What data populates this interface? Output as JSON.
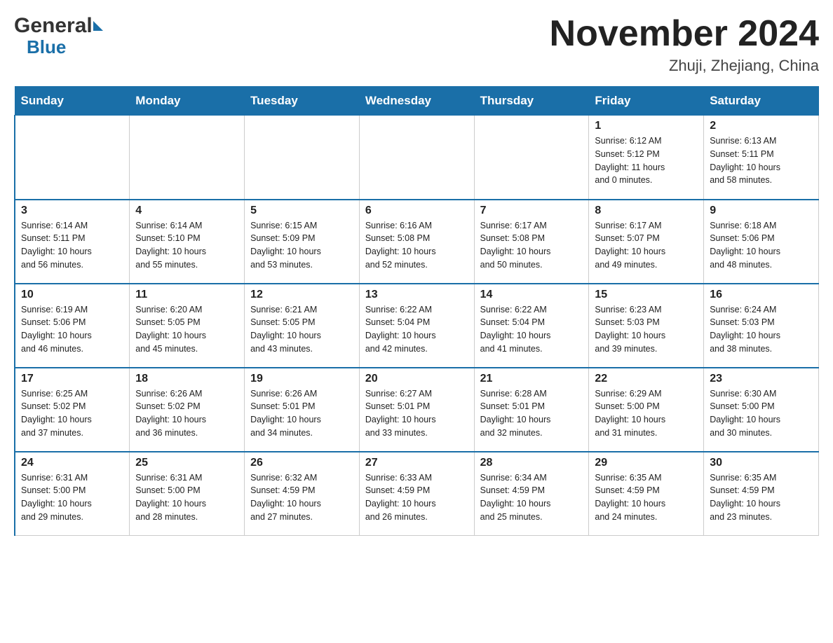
{
  "header": {
    "title": "November 2024",
    "subtitle": "Zhuji, Zhejiang, China",
    "logo_general": "General",
    "logo_blue": "Blue"
  },
  "weekdays": [
    "Sunday",
    "Monday",
    "Tuesday",
    "Wednesday",
    "Thursday",
    "Friday",
    "Saturday"
  ],
  "weeks": [
    [
      {
        "day": "",
        "info": ""
      },
      {
        "day": "",
        "info": ""
      },
      {
        "day": "",
        "info": ""
      },
      {
        "day": "",
        "info": ""
      },
      {
        "day": "",
        "info": ""
      },
      {
        "day": "1",
        "info": "Sunrise: 6:12 AM\nSunset: 5:12 PM\nDaylight: 11 hours\nand 0 minutes."
      },
      {
        "day": "2",
        "info": "Sunrise: 6:13 AM\nSunset: 5:11 PM\nDaylight: 10 hours\nand 58 minutes."
      }
    ],
    [
      {
        "day": "3",
        "info": "Sunrise: 6:14 AM\nSunset: 5:11 PM\nDaylight: 10 hours\nand 56 minutes."
      },
      {
        "day": "4",
        "info": "Sunrise: 6:14 AM\nSunset: 5:10 PM\nDaylight: 10 hours\nand 55 minutes."
      },
      {
        "day": "5",
        "info": "Sunrise: 6:15 AM\nSunset: 5:09 PM\nDaylight: 10 hours\nand 53 minutes."
      },
      {
        "day": "6",
        "info": "Sunrise: 6:16 AM\nSunset: 5:08 PM\nDaylight: 10 hours\nand 52 minutes."
      },
      {
        "day": "7",
        "info": "Sunrise: 6:17 AM\nSunset: 5:08 PM\nDaylight: 10 hours\nand 50 minutes."
      },
      {
        "day": "8",
        "info": "Sunrise: 6:17 AM\nSunset: 5:07 PM\nDaylight: 10 hours\nand 49 minutes."
      },
      {
        "day": "9",
        "info": "Sunrise: 6:18 AM\nSunset: 5:06 PM\nDaylight: 10 hours\nand 48 minutes."
      }
    ],
    [
      {
        "day": "10",
        "info": "Sunrise: 6:19 AM\nSunset: 5:06 PM\nDaylight: 10 hours\nand 46 minutes."
      },
      {
        "day": "11",
        "info": "Sunrise: 6:20 AM\nSunset: 5:05 PM\nDaylight: 10 hours\nand 45 minutes."
      },
      {
        "day": "12",
        "info": "Sunrise: 6:21 AM\nSunset: 5:05 PM\nDaylight: 10 hours\nand 43 minutes."
      },
      {
        "day": "13",
        "info": "Sunrise: 6:22 AM\nSunset: 5:04 PM\nDaylight: 10 hours\nand 42 minutes."
      },
      {
        "day": "14",
        "info": "Sunrise: 6:22 AM\nSunset: 5:04 PM\nDaylight: 10 hours\nand 41 minutes."
      },
      {
        "day": "15",
        "info": "Sunrise: 6:23 AM\nSunset: 5:03 PM\nDaylight: 10 hours\nand 39 minutes."
      },
      {
        "day": "16",
        "info": "Sunrise: 6:24 AM\nSunset: 5:03 PM\nDaylight: 10 hours\nand 38 minutes."
      }
    ],
    [
      {
        "day": "17",
        "info": "Sunrise: 6:25 AM\nSunset: 5:02 PM\nDaylight: 10 hours\nand 37 minutes."
      },
      {
        "day": "18",
        "info": "Sunrise: 6:26 AM\nSunset: 5:02 PM\nDaylight: 10 hours\nand 36 minutes."
      },
      {
        "day": "19",
        "info": "Sunrise: 6:26 AM\nSunset: 5:01 PM\nDaylight: 10 hours\nand 34 minutes."
      },
      {
        "day": "20",
        "info": "Sunrise: 6:27 AM\nSunset: 5:01 PM\nDaylight: 10 hours\nand 33 minutes."
      },
      {
        "day": "21",
        "info": "Sunrise: 6:28 AM\nSunset: 5:01 PM\nDaylight: 10 hours\nand 32 minutes."
      },
      {
        "day": "22",
        "info": "Sunrise: 6:29 AM\nSunset: 5:00 PM\nDaylight: 10 hours\nand 31 minutes."
      },
      {
        "day": "23",
        "info": "Sunrise: 6:30 AM\nSunset: 5:00 PM\nDaylight: 10 hours\nand 30 minutes."
      }
    ],
    [
      {
        "day": "24",
        "info": "Sunrise: 6:31 AM\nSunset: 5:00 PM\nDaylight: 10 hours\nand 29 minutes."
      },
      {
        "day": "25",
        "info": "Sunrise: 6:31 AM\nSunset: 5:00 PM\nDaylight: 10 hours\nand 28 minutes."
      },
      {
        "day": "26",
        "info": "Sunrise: 6:32 AM\nSunset: 4:59 PM\nDaylight: 10 hours\nand 27 minutes."
      },
      {
        "day": "27",
        "info": "Sunrise: 6:33 AM\nSunset: 4:59 PM\nDaylight: 10 hours\nand 26 minutes."
      },
      {
        "day": "28",
        "info": "Sunrise: 6:34 AM\nSunset: 4:59 PM\nDaylight: 10 hours\nand 25 minutes."
      },
      {
        "day": "29",
        "info": "Sunrise: 6:35 AM\nSunset: 4:59 PM\nDaylight: 10 hours\nand 24 minutes."
      },
      {
        "day": "30",
        "info": "Sunrise: 6:35 AM\nSunset: 4:59 PM\nDaylight: 10 hours\nand 23 minutes."
      }
    ]
  ]
}
